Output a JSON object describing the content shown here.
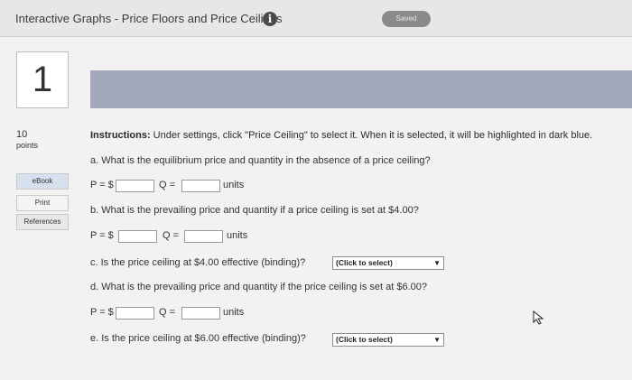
{
  "header": {
    "title": "Interactive Graphs - Price Floors and Price Ceilings",
    "info_icon": "i",
    "saved_label": "Saved"
  },
  "question": {
    "number": "1",
    "points_value": "10",
    "points_label": "points"
  },
  "sidebar": {
    "ebook_label": "eBook",
    "print_label": "Print",
    "references_label": "References"
  },
  "instructions": {
    "lead": "Instructions:",
    "text": " Under settings, click \"Price Ceiling\" to select it. When it is selected, it will be highlighted in dark blue."
  },
  "parts": {
    "a": {
      "text": "a. What is the equilibrium price and quantity in the absence of a price ceiling?",
      "p_label": "P = $",
      "q_label": "Q =",
      "units": "units",
      "p_value": "",
      "q_value": ""
    },
    "b": {
      "text": "b. What is the prevailing price and quantity if a price ceiling is set at $4.00?",
      "p_label": "P = $",
      "q_label": "Q =",
      "units": "units",
      "p_value": "",
      "q_value": ""
    },
    "c": {
      "text": "c. Is the price ceiling at $4.00 effective (binding)?",
      "select_value": "(Click to select)"
    },
    "d": {
      "text": "d. What is the prevailing price and quantity if the price ceiling is set at $6.00?",
      "p_label": "P = $",
      "q_label": "Q =",
      "units": "units",
      "p_value": "",
      "q_value": ""
    },
    "e": {
      "text": "e. Is the price ceiling at $6.00 effective (binding)?",
      "select_value": "(Click to select)"
    }
  },
  "colors": {
    "header_band": "#a3a9bc",
    "ebook_bg": "#d7e0ef",
    "saved_badge": "#8a8a8a"
  }
}
